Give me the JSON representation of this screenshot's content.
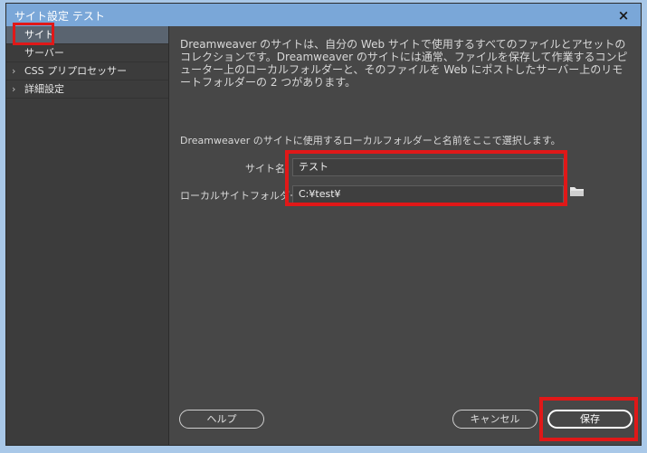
{
  "window": {
    "title": "サイト設定 テスト",
    "close_glyph": "×"
  },
  "sidebar": {
    "items": [
      {
        "label": "サイト",
        "chevron": ""
      },
      {
        "label": "サーバー",
        "chevron": ""
      },
      {
        "label": "CSS プリプロセッサー",
        "chevron": "›"
      },
      {
        "label": "詳細設定",
        "chevron": "›"
      }
    ]
  },
  "content": {
    "description": "Dreamweaver のサイトは、自分の Web サイトで使用するすべてのファイルとアセットのコレクションです。Dreamweaver のサイトには通常、ファイルを保存して作業するコンピューター上のローカルフォルダーと、そのファイルを Web にポストしたサーバー上のリモートフォルダーの 2 つがあります。",
    "form_intro": "Dreamweaver のサイトに使用するローカルフォルダーと名前をここで選択します。",
    "site_name_label": "サイト名",
    "site_name_value": "テスト",
    "local_folder_label": "ローカルサイトフォルダー",
    "local_folder_value": "C:¥test¥"
  },
  "buttons": {
    "help": "ヘルプ",
    "cancel": "キャンセル",
    "save": "保存"
  },
  "icons": {
    "folder": "folder-icon"
  },
  "colors": {
    "highlight": "#e01818",
    "titlebar": "#7aa7d8",
    "panel": "#474747"
  }
}
